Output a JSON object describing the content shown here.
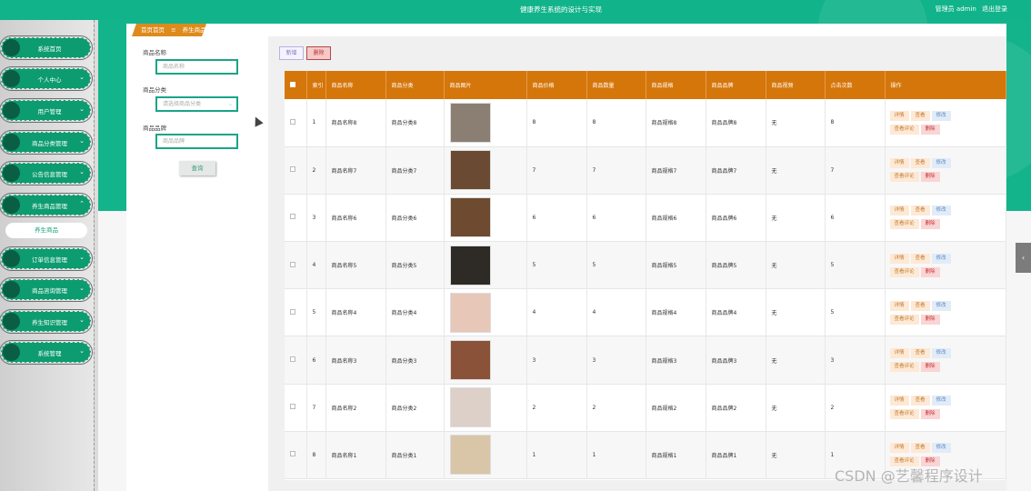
{
  "header": {
    "app_title": "健康养生系统的设计与实现",
    "user": "管理员 admin",
    "logout": "退出登录"
  },
  "sidebar": {
    "items": [
      {
        "label": "系统首页",
        "chevron": ""
      },
      {
        "label": "个人中心",
        "chevron": "⌄"
      },
      {
        "label": "用户管理",
        "chevron": "⌄"
      },
      {
        "label": "商品分类管理",
        "chevron": "⌄"
      },
      {
        "label": "公告信息管理",
        "chevron": "⌄"
      },
      {
        "label": "养生商品管理",
        "chevron": "⌃"
      },
      {
        "label": "订单信息管理",
        "chevron": "⌄"
      },
      {
        "label": "商品咨询管理",
        "chevron": "⌄"
      },
      {
        "label": "养生知识管理",
        "chevron": "⌄"
      },
      {
        "label": "系统管理",
        "chevron": "⌄"
      }
    ],
    "active_sub": "养生商品"
  },
  "breadcrumb": {
    "home": "首页首页",
    "sep": "≡",
    "current": "养生商品"
  },
  "search": {
    "name_label": "商品名称",
    "name_placeholder": "商品名称",
    "category_label": "商品分类",
    "category_placeholder": "请选择商品分类",
    "brand_label": "商品品牌",
    "brand_placeholder": "商品品牌",
    "button": "查询"
  },
  "actions": {
    "add": "新增",
    "delete": "删除"
  },
  "table": {
    "headers": [
      "索引",
      "商品名称",
      "商品分类",
      "商品图片",
      "商品价格",
      "商品数量",
      "商品规格",
      "商品品牌",
      "商品视频",
      "点击次数",
      "操作"
    ],
    "ops": {
      "detail": "详情",
      "fav": "查看",
      "edit": "修改",
      "review": "查看评论",
      "delete": "删除"
    },
    "rows": [
      {
        "idx": "1",
        "name": "商品名称8",
        "cat": "商品分类8",
        "price": "8",
        "qty": "8",
        "spec": "商品规格8",
        "brand": "商品品牌8",
        "video": "无",
        "clicks": "8",
        "img": "#8a7f72"
      },
      {
        "idx": "2",
        "name": "商品名称7",
        "cat": "商品分类7",
        "price": "7",
        "qty": "7",
        "spec": "商品规格7",
        "brand": "商品品牌7",
        "video": "无",
        "clicks": "7",
        "img": "#6a4a32"
      },
      {
        "idx": "3",
        "name": "商品名称6",
        "cat": "商品分类6",
        "price": "6",
        "qty": "6",
        "spec": "商品规格6",
        "brand": "商品品牌6",
        "video": "无",
        "clicks": "6",
        "img": "#6e4a30"
      },
      {
        "idx": "4",
        "name": "商品名称5",
        "cat": "商品分类5",
        "price": "5",
        "qty": "5",
        "spec": "商品规格5",
        "brand": "商品品牌5",
        "video": "无",
        "clicks": "5",
        "img": "#2e2a26"
      },
      {
        "idx": "5",
        "name": "商品名称4",
        "cat": "商品分类4",
        "price": "4",
        "qty": "4",
        "spec": "商品规格4",
        "brand": "商品品牌4",
        "video": "无",
        "clicks": "5",
        "img": "#e6c7b8"
      },
      {
        "idx": "6",
        "name": "商品名称3",
        "cat": "商品分类3",
        "price": "3",
        "qty": "3",
        "spec": "商品规格3",
        "brand": "商品品牌3",
        "video": "无",
        "clicks": "3",
        "img": "#8a5238"
      },
      {
        "idx": "7",
        "name": "商品名称2",
        "cat": "商品分类2",
        "price": "2",
        "qty": "2",
        "spec": "商品规格2",
        "brand": "商品品牌2",
        "video": "无",
        "clicks": "2",
        "img": "#ddd0c8"
      },
      {
        "idx": "8",
        "name": "商品名称1",
        "cat": "商品分类1",
        "price": "1",
        "qty": "1",
        "spec": "商品规格1",
        "brand": "商品品牌1",
        "video": "无",
        "clicks": "1",
        "img": "#d9c6a8"
      }
    ]
  },
  "watermark": "CSDN @艺馨程序设计",
  "colors": {
    "primary": "#11b38a",
    "header_row": "#d5760a",
    "accent": "#dd8b1c"
  }
}
